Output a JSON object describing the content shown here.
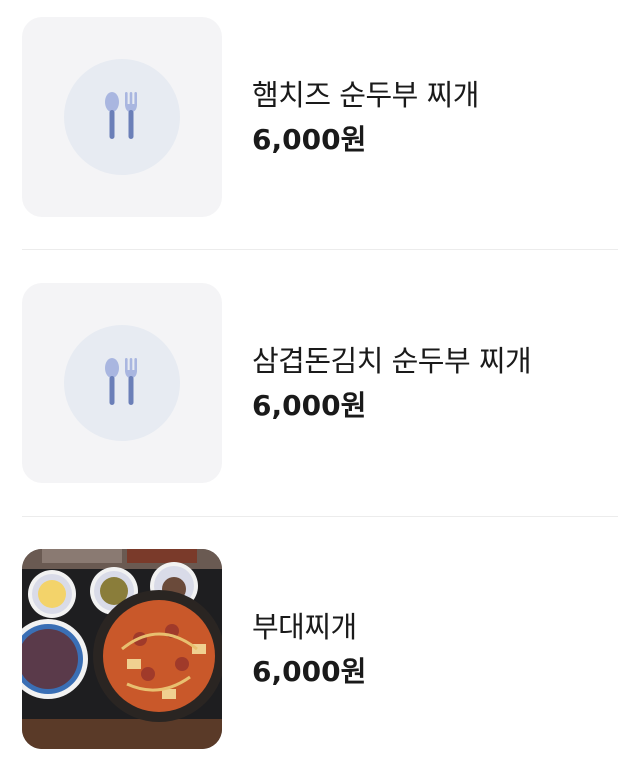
{
  "menu": {
    "items": [
      {
        "name": "햄치즈 순두부 찌개",
        "price": "6,000원",
        "image": "utensils-placeholder-icon"
      },
      {
        "name": "삼겹돈김치 순두부 찌개",
        "price": "6,000원",
        "image": "utensils-placeholder-icon"
      },
      {
        "name": "부대찌개",
        "price": "6,000원",
        "image": "food-photo"
      }
    ]
  },
  "colors": {
    "thumb_bg": "#f4f4f6",
    "placeholder_circle": "#e7ebf2",
    "icon": "#7f8fbf",
    "divider": "#ececec",
    "text": "#1a1a1a"
  }
}
